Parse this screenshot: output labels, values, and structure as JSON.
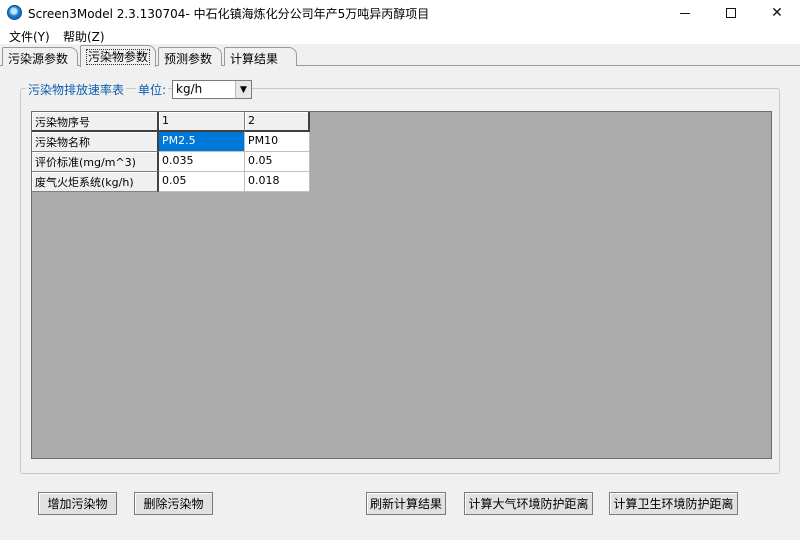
{
  "window": {
    "title": "Screen3Model 2.3.130704- 中石化镇海炼化分公司年产5万吨异丙醇项目",
    "min_glyph": "",
    "max_glyph": "",
    "close_glyph": "✕"
  },
  "menu": {
    "file": "文件(Y)",
    "help": "帮助(Z)"
  },
  "tabs": [
    "污染源参数",
    "污染物参数",
    "预测参数",
    "计算结果"
  ],
  "active_tab": 1,
  "group": {
    "title": "污染物排放速率表",
    "unit_label": "单位:",
    "unit_value": "kg/h"
  },
  "grid": {
    "row_headers": [
      "污染物序号",
      "污染物名称",
      "评价标准(mg/m^3)",
      "废气火炬系统(kg/h)"
    ],
    "columns": [
      [
        "1",
        "PM2.5",
        "0.035",
        "0.05"
      ],
      [
        "2",
        "PM10",
        "0.05",
        "0.018"
      ]
    ],
    "selected_cell": "PM2.5"
  },
  "buttons": {
    "add": "增加污染物",
    "delete": "删除污染物",
    "refresh": "刷新计算结果",
    "atmos": "计算大气环境防护距离",
    "health": "计算卫生环境防护距离"
  }
}
